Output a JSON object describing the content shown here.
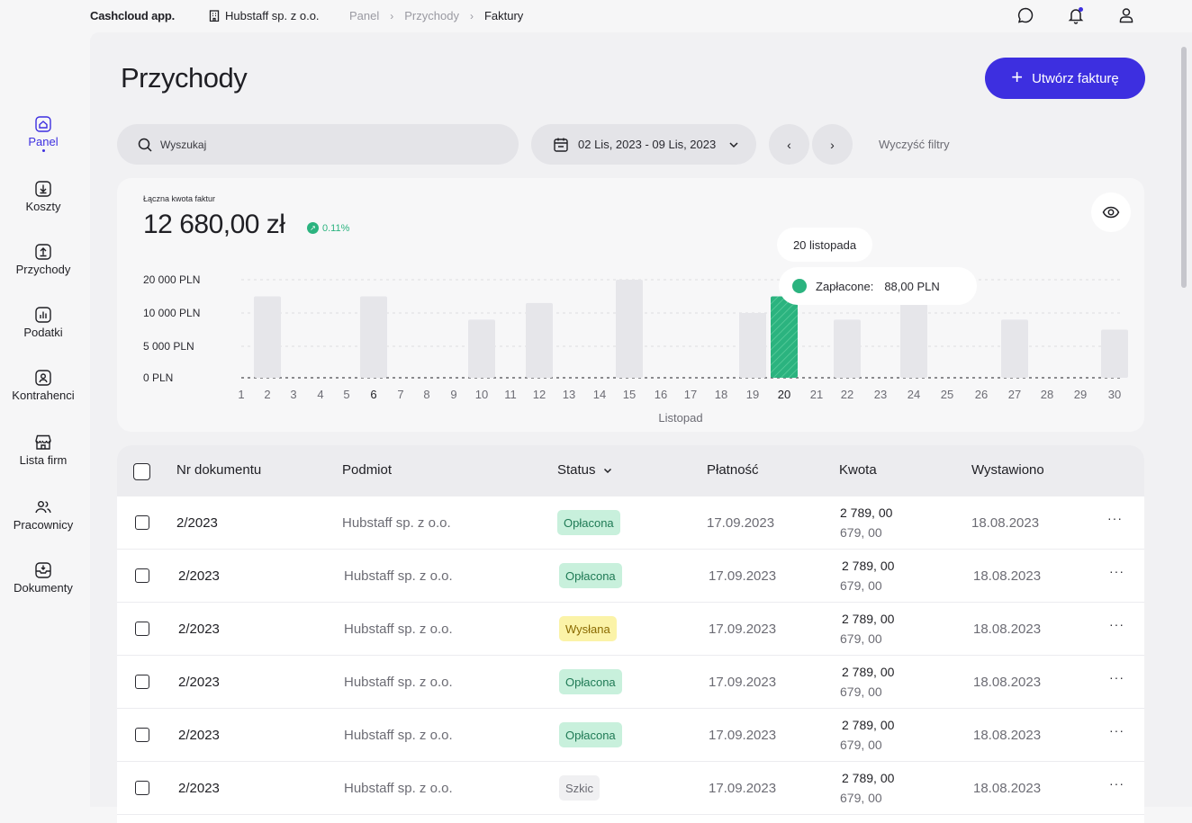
{
  "app": {
    "brand": "Cashcloud app.",
    "company": "Hubstaff sp. z o.o."
  },
  "breadcrumbs": [
    "Panel",
    "Przychody",
    "Faktury"
  ],
  "sidebar": {
    "items": [
      {
        "label": "Panel",
        "icon": "home-icon",
        "active": true
      },
      {
        "label": "Koszty",
        "icon": "download-box-icon"
      },
      {
        "label": "Przychody",
        "icon": "upload-box-icon"
      },
      {
        "label": "Podatki",
        "icon": "bar-chart-icon"
      },
      {
        "label": "Kontrahenci",
        "icon": "contact-icon"
      },
      {
        "label": "Lista firm",
        "icon": "store-icon"
      },
      {
        "label": "Pracownicy",
        "icon": "users-icon"
      },
      {
        "label": "Dokumenty",
        "icon": "inbox-icon"
      }
    ]
  },
  "page": {
    "title": "Przychody",
    "create_button": "Utwórz fakturę"
  },
  "filters": {
    "search_placeholder": "Wyszukaj",
    "date_range": "02 Lis, 2023 - 09 Lis, 2023",
    "clear": "Wyczyść filtry"
  },
  "summary": {
    "label": "Łączna kwota faktur",
    "value": "12 680,00 zł",
    "change": "0.11%"
  },
  "tooltip": {
    "date": "20 listopada",
    "label": "Zapłacone:",
    "amount": "88,00 PLN"
  },
  "chart_data": {
    "type": "bar",
    "xlabel": "Listopad",
    "y_ticks": [
      "20 000 PLN",
      "10 000 PLN",
      "5 000 PLN",
      "0 PLN"
    ],
    "y_tick_values": [
      20000,
      10000,
      5000,
      0
    ],
    "categories": [
      "1",
      "2",
      "3",
      "4",
      "5",
      "6",
      "7",
      "8",
      "9",
      "10",
      "11",
      "12",
      "13",
      "14",
      "15",
      "16",
      "17",
      "18",
      "19",
      "20",
      "21",
      "22",
      "23",
      "24",
      "25",
      "26",
      "27",
      "28",
      "29",
      "30"
    ],
    "values": [
      0,
      15000,
      0,
      0,
      0,
      15000,
      0,
      0,
      0,
      9000,
      0,
      13000,
      0,
      0,
      20000,
      0,
      0,
      0,
      10000,
      15000,
      0,
      9000,
      0,
      21000,
      0,
      0,
      9000,
      0,
      0,
      7500
    ],
    "highlight_category": "20",
    "colors": {
      "bar": "#e6e6ea",
      "highlight": "#2bb37f"
    }
  },
  "table": {
    "headers": [
      "Nr dokumentu",
      "Podmiot",
      "Status",
      "Płatność",
      "Kwota",
      "Wystawiono"
    ],
    "rows": [
      {
        "nr": "2/2023",
        "podmiot": "Hubstaff sp. z o.o.",
        "status": "Opłacona",
        "status_type": "paid",
        "platnosc": "17.09.2023",
        "kwota1": "2 789, 00",
        "kwota2": "679, 00",
        "wystawiono": "18.08.2023"
      },
      {
        "nr": "2/2023",
        "podmiot": "Hubstaff sp. z o.o.",
        "status": "Opłacona",
        "status_type": "paid",
        "platnosc": "17.09.2023",
        "kwota1": "2 789, 00",
        "kwota2": "679, 00",
        "wystawiono": "18.08.2023"
      },
      {
        "nr": "2/2023",
        "podmiot": "Hubstaff sp. z o.o.",
        "status": "Wysłana",
        "status_type": "sent",
        "platnosc": "17.09.2023",
        "kwota1": "2 789, 00",
        "kwota2": "679, 00",
        "wystawiono": "18.08.2023"
      },
      {
        "nr": "2/2023",
        "podmiot": "Hubstaff sp. z o.o.",
        "status": "Opłacona",
        "status_type": "paid",
        "platnosc": "17.09.2023",
        "kwota1": "2 789, 00",
        "kwota2": "679, 00",
        "wystawiono": "18.08.2023"
      },
      {
        "nr": "2/2023",
        "podmiot": "Hubstaff sp. z o.o.",
        "status": "Opłacona",
        "status_type": "paid",
        "platnosc": "17.09.2023",
        "kwota1": "2 789, 00",
        "kwota2": "679, 00",
        "wystawiono": "18.08.2023"
      },
      {
        "nr": "2/2023",
        "podmiot": "Hubstaff sp. z o.o.",
        "status": "Szkic",
        "status_type": "draft",
        "platnosc": "17.09.2023",
        "kwota1": "2 789, 00",
        "kwota2": "679, 00",
        "wystawiono": "18.08.2023"
      }
    ],
    "row_menu": "···"
  },
  "colors": {
    "accent": "#3d2fe0",
    "success": "#2bb37f"
  }
}
